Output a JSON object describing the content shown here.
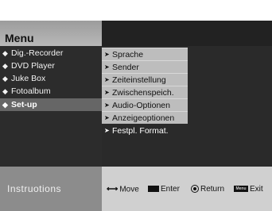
{
  "header": {
    "title": "Menu"
  },
  "main_menu": {
    "items": [
      {
        "label": "Dig.-Recorder",
        "selected": false
      },
      {
        "label": "DVD Player",
        "selected": false
      },
      {
        "label": "Juke Box",
        "selected": false
      },
      {
        "label": "Fotoalbum",
        "selected": false
      },
      {
        "label": "Set-up",
        "selected": true
      }
    ],
    "bullet_icon": "diamond-bullet-icon"
  },
  "submenu": {
    "items": [
      {
        "label": "Sprache",
        "selected": false
      },
      {
        "label": "Sender",
        "selected": false
      },
      {
        "label": "Zeiteinstellung",
        "selected": false
      },
      {
        "label": "Zwischenspeich.",
        "selected": false
      },
      {
        "label": "Audio-Optionen",
        "selected": false
      },
      {
        "label": "Anzeigeoptionen",
        "selected": false
      },
      {
        "label": "Festpl. Format.",
        "selected": true
      }
    ],
    "arrow_icon": "arrow-right-icon"
  },
  "footer": {
    "title": "Instruotions",
    "instructions": [
      {
        "icon": "move-arrows-icon",
        "label": "Move"
      },
      {
        "icon": "enter-key-icon",
        "label": "Enter"
      },
      {
        "icon": "return-button-icon",
        "label": "Return"
      },
      {
        "icon": "menu-key-icon",
        "icon_text": "Menu",
        "label": "Exit"
      }
    ]
  },
  "colors": {
    "header_bg": "#b0b0b0",
    "panel_bg": "#2c2c2c",
    "submenu_item_bg": "#bdbdbd",
    "selected_bg": "#666666",
    "footer_left_bg": "#8c8c8c",
    "footer_right_bg": "#d0d0d0"
  }
}
